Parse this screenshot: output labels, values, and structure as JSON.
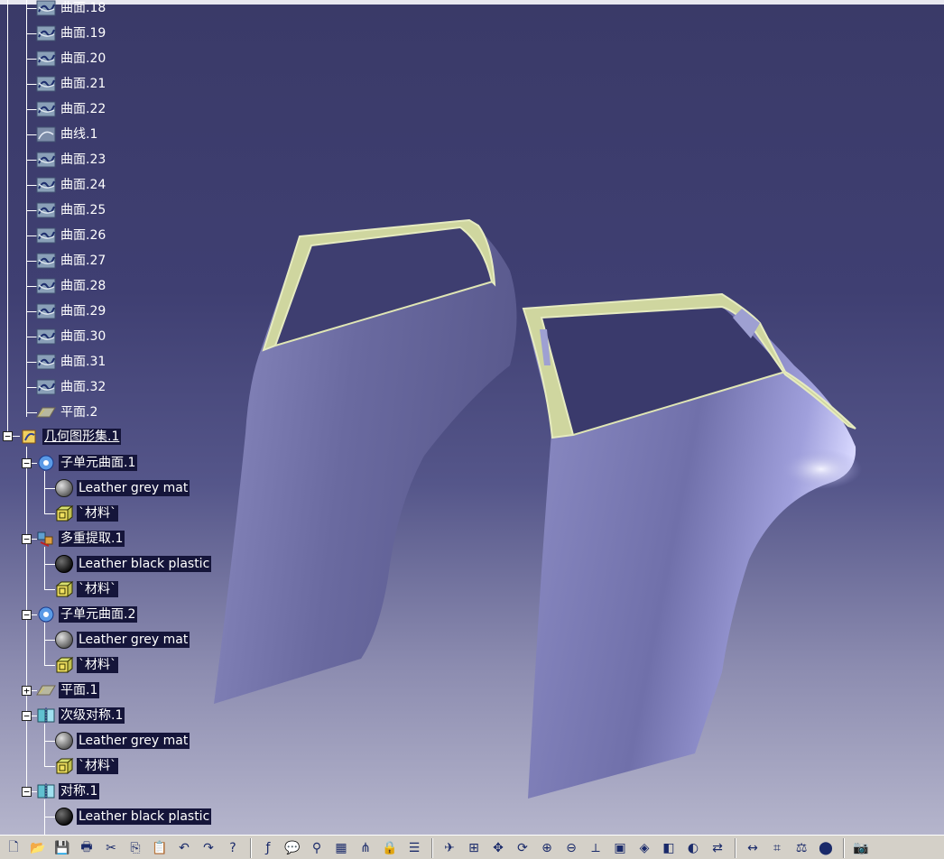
{
  "tree": {
    "surface_items": [
      {
        "label": "曲面.18",
        "icon": "surface-icon"
      },
      {
        "label": "曲面.19",
        "icon": "surface-icon"
      },
      {
        "label": "曲面.20",
        "icon": "surface-icon"
      },
      {
        "label": "曲面.21",
        "icon": "surface-icon"
      },
      {
        "label": "曲面.22",
        "icon": "surface-icon"
      },
      {
        "label": "曲线.1",
        "icon": "curve-icon"
      },
      {
        "label": "曲面.23",
        "icon": "surface-icon"
      },
      {
        "label": "曲面.24",
        "icon": "surface-icon"
      },
      {
        "label": "曲面.25",
        "icon": "surface-icon"
      },
      {
        "label": "曲面.26",
        "icon": "surface-icon"
      },
      {
        "label": "曲面.27",
        "icon": "surface-icon"
      },
      {
        "label": "曲面.28",
        "icon": "surface-icon"
      },
      {
        "label": "曲面.29",
        "icon": "surface-icon"
      },
      {
        "label": "曲面.30",
        "icon": "surface-icon"
      },
      {
        "label": "曲面.31",
        "icon": "surface-icon"
      },
      {
        "label": "曲面.32",
        "icon": "surface-icon"
      },
      {
        "label": "平面.2",
        "icon": "plane-icon"
      }
    ],
    "geo_set": {
      "label": "几何图形集.1",
      "icon": "geometrical-set-icon"
    },
    "children": [
      {
        "label": "子单元曲面.1",
        "icon": "subelement-surface-icon",
        "toggle": "−",
        "material": "Leather grey mat",
        "material_icon": "grey-sphere-icon",
        "material_node": "`材料`"
      },
      {
        "label": "多重提取.1",
        "icon": "multi-extract-icon",
        "toggle": "−",
        "material": "Leather black plastic",
        "material_icon": "black-sphere-icon",
        "material_node": "`材料`"
      },
      {
        "label": "子单元曲面.2",
        "icon": "subelement-surface-icon",
        "toggle": "−",
        "material": "Leather grey mat",
        "material_icon": "grey-sphere-icon",
        "material_node": "`材料`"
      },
      {
        "label": "平面.1",
        "icon": "plane-icon",
        "toggle": "+"
      },
      {
        "label": "次级对称.1",
        "icon": "symmetry-icon",
        "toggle": "−",
        "material": "Leather grey mat",
        "material_icon": "grey-sphere-icon",
        "material_node": "`材料`"
      },
      {
        "label": "对称.1",
        "icon": "symmetry-icon",
        "toggle": "−",
        "material": "Leather black plastic",
        "material_icon": "black-sphere-icon"
      }
    ]
  },
  "colors": {
    "background_top": "#3a3a68",
    "background_bottom": "#b5b5cc",
    "door_surface": "#7a7ab0",
    "frame_highlight": "#d8deb0"
  },
  "toolbar": {
    "buttons": [
      "new-icon",
      "open-icon",
      "save-icon",
      "print-icon",
      "cut-icon",
      "copy-icon",
      "paste-icon",
      "undo-icon",
      "redo-icon",
      "whats-this-icon",
      "formula-icon",
      "comment-icon",
      "hyperlink-icon",
      "table-icon",
      "tree-icon",
      "lock-icon",
      "catalog-icon",
      "fly-mode-icon",
      "fit-all-icon",
      "pan-icon",
      "rotate-icon",
      "zoom-in-icon",
      "zoom-out-icon",
      "normal-view-icon",
      "multi-view-icon",
      "iso-view-icon",
      "shading-icon",
      "hide-show-icon",
      "swap-icon",
      "measure-icon",
      "measure-item-icon",
      "inertia-icon",
      "apply-material-icon",
      "capture-icon"
    ]
  }
}
